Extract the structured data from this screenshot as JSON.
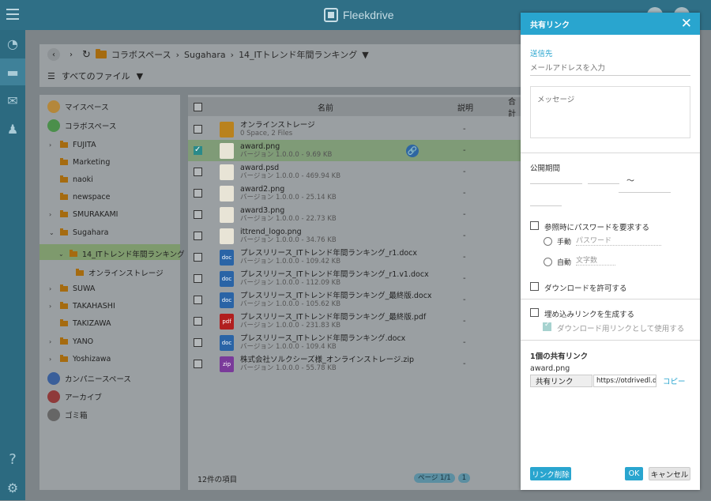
{
  "app": {
    "brand": "Fleekdrive"
  },
  "breadcrumb": {
    "root": "コラボスペース",
    "user": "Sugahara",
    "folder": "14_ITトレンド年間ランキング"
  },
  "filter": {
    "label": "すべてのファイル"
  },
  "tree": [
    {
      "label": "マイスペース"
    },
    {
      "label": "コラボスペース"
    },
    {
      "label": "FUJITA"
    },
    {
      "label": "Marketing"
    },
    {
      "label": "naoki"
    },
    {
      "label": "newspace"
    },
    {
      "label": "SMURAKAMI"
    },
    {
      "label": "Sugahara"
    },
    {
      "label": "14_ITトレンド年間ランキング"
    },
    {
      "label": "オンラインストレージ"
    },
    {
      "label": "SUWA"
    },
    {
      "label": "TAKAHASHI"
    },
    {
      "label": "TAKIZAWA"
    },
    {
      "label": "YANO"
    },
    {
      "label": "Yoshizawa"
    },
    {
      "label": "カンパニースペース"
    },
    {
      "label": "アーカイブ"
    },
    {
      "label": "ゴミ箱"
    }
  ],
  "filelist": {
    "col_name": "名前",
    "col_desc": "説明",
    "col_total": "合計",
    "dash": "-",
    "files": [
      {
        "name": "オンラインストレージ",
        "sub": "0 Space, 2 Files",
        "type": "folder"
      },
      {
        "name": "award.png",
        "sub": "バージョン 1.0.0.0 - 9.69 KB",
        "type": "img"
      },
      {
        "name": "award.psd",
        "sub": "バージョン 1.0.0.0 - 469.94 KB",
        "type": "img"
      },
      {
        "name": "award2.png",
        "sub": "バージョン 1.0.0.0 - 25.14 KB",
        "type": "img"
      },
      {
        "name": "award3.png",
        "sub": "バージョン 1.0.0.0 - 22.73 KB",
        "type": "img"
      },
      {
        "name": "ittrend_logo.png",
        "sub": "バージョン 1.0.0.0 - 34.76 KB",
        "type": "img"
      },
      {
        "name": "プレスリリース_ITトレンド年間ランキング_r1.docx",
        "sub": "バージョン 1.0.0.0 - 109.42 KB",
        "type": "doc"
      },
      {
        "name": "プレスリリース_ITトレンド年間ランキング_r1.v1.docx",
        "sub": "バージョン 1.0.0.0 - 112.09 KB",
        "type": "doc"
      },
      {
        "name": "プレスリリース_ITトレンド年間ランキング_最終版.docx",
        "sub": "バージョン 1.0.0.0 - 105.62 KB",
        "type": "doc"
      },
      {
        "name": "プレスリリース_ITトレンド年間ランキング_最終版.pdf",
        "sub": "バージョン 1.0.0.0 - 231.83 KB",
        "type": "pdf"
      },
      {
        "name": "プレスリリース_ITトレンド年間ランキング.docx",
        "sub": "バージョン 1.0.0.0 - 109.4 KB",
        "type": "doc"
      },
      {
        "name": "株式会社ソルクシーズ様_オンラインストレージ.zip",
        "sub": "バージョン 1.0.0.0 - 55.78 KB",
        "type": "zip"
      }
    ],
    "footer_count": "12件の項目",
    "page": "ページ 1/1",
    "page_num": "1"
  },
  "share": {
    "title": "共有リンク",
    "recipient_label": "送信先",
    "email_placeholder": "メールアドレスを入力",
    "message_placeholder": "メッセージ",
    "period_label": "公開期間",
    "period_sep": "～",
    "require_password": "参照時にパスワードを要求する",
    "manual": "手動",
    "password_placeholder": "パスワード",
    "auto": "自動",
    "chars_placeholder": "文字数",
    "allow_download": "ダウンロードを許可する",
    "embed_link": "埋め込みリンクを生成する",
    "use_download_link": "ダウンロード用リンクとして使用する",
    "count_label": "1個の共有リンク",
    "file_name": "award.png",
    "link_tag": "共有リンク",
    "link_url": "https://otdrivedl.de",
    "copy": "コピー",
    "delete_link": "リンク削除",
    "ok": "OK",
    "cancel": "キャンセル"
  },
  "file_icon_labels": {
    "doc": "doc",
    "pdf": "pdf",
    "zip": "zip"
  },
  "colors": {
    "accent": "#29a5cf",
    "header": "#2f6f86"
  }
}
